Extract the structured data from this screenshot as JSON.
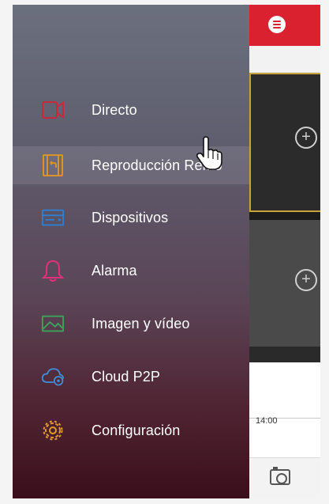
{
  "drawer": {
    "items": [
      {
        "label": "Directo",
        "icon": "live-video-icon",
        "active": false,
        "color": "#c9283a"
      },
      {
        "label": "Reproducción Remo",
        "icon": "playback-film-icon",
        "active": true,
        "color": "#d9922e"
      },
      {
        "label": "Dispositivos",
        "icon": "dvr-device-icon",
        "active": false,
        "color": "#2f7fd1"
      },
      {
        "label": "Alarma",
        "icon": "bell-icon",
        "active": false,
        "color": "#e0307a"
      },
      {
        "label": "Imagen y vídeo",
        "icon": "image-icon",
        "active": false,
        "color": "#3da35b"
      },
      {
        "label": "Cloud P2P",
        "icon": "cloud-icon",
        "active": false,
        "color": "#3f8ed6"
      },
      {
        "label": "Configuración",
        "icon": "gear-icon",
        "active": false,
        "color": "#e39a2c"
      }
    ]
  },
  "app": {
    "header_color": "#d9212f",
    "time_label": "14:00"
  }
}
